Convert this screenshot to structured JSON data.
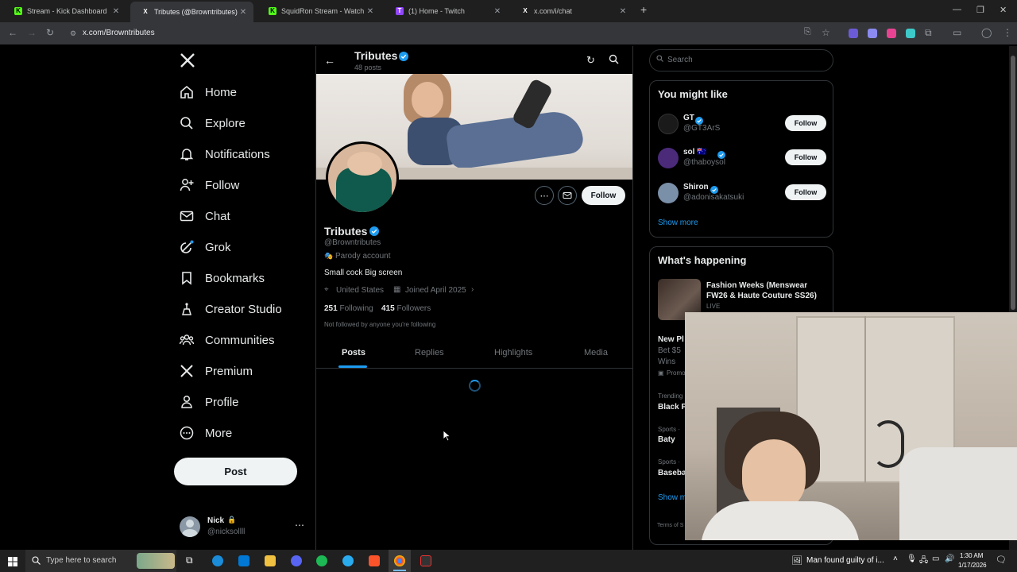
{
  "browser": {
    "tabs": [
      {
        "title": "Stream - Kick Dashboard",
        "fav": "K",
        "fav_color": "#53fc18",
        "active": false
      },
      {
        "title": "Tributes (@Browntributes) / X",
        "fav": "X",
        "fav_color": "#ffffff",
        "active": true
      },
      {
        "title": "SquidRon Stream - Watch Live",
        "fav": "K",
        "fav_color": "#53fc18",
        "active": false
      },
      {
        "title": "(1) Home - Twitch",
        "fav": "T",
        "fav_color": "#9146ff",
        "active": false
      },
      {
        "title": "x.com/i/chat",
        "fav": "X",
        "fav_color": "#ffffff",
        "active": false
      }
    ],
    "url": "x.com/Browntributes"
  },
  "nav": {
    "items": [
      {
        "label": "Home",
        "icon": "home-icon"
      },
      {
        "label": "Explore",
        "icon": "search-icon"
      },
      {
        "label": "Notifications",
        "icon": "bell-icon"
      },
      {
        "label": "Follow",
        "icon": "person-add-icon"
      },
      {
        "label": "Chat",
        "icon": "mail-icon"
      },
      {
        "label": "Grok",
        "icon": "grok-icon"
      },
      {
        "label": "Bookmarks",
        "icon": "bookmark-icon"
      },
      {
        "label": "Creator Studio",
        "icon": "creator-icon"
      },
      {
        "label": "Communities",
        "icon": "communities-icon"
      },
      {
        "label": "Premium",
        "icon": "x-logo-icon"
      },
      {
        "label": "Profile",
        "icon": "person-icon"
      },
      {
        "label": "More",
        "icon": "more-circle-icon"
      }
    ],
    "post_label": "Post",
    "account": {
      "name": "Nick",
      "handle": "@nicksollll"
    }
  },
  "profile": {
    "header_name": "Tributes",
    "post_count": "48 posts",
    "name": "Tributes",
    "handle": "@Browntributes",
    "parody": "Parody account",
    "bio": "Small cock Big screen",
    "location": "United States",
    "joined": "Joined April 2025",
    "following_count": "251",
    "following_label": "Following",
    "followers_count": "415",
    "followers_label": "Followers",
    "not_followed": "Not followed by anyone you're following",
    "follow_label": "Follow",
    "tabs": [
      "Posts",
      "Replies",
      "Highlights",
      "Media"
    ],
    "active_tab": "Posts"
  },
  "right": {
    "search_placeholder": "Search",
    "you_might_like": {
      "title": "You might like",
      "accounts": [
        {
          "name": "GT",
          "handle": "@GT3ArS",
          "follow": "Follow",
          "avatar_color": "#1a1a1a"
        },
        {
          "name": "sol 🇦🇺",
          "handle": "@thaboysol",
          "follow": "Follow",
          "avatar_color": "#4b2a7a"
        },
        {
          "name": "Shiron",
          "handle": "@adonisakatsuki",
          "follow": "Follow",
          "avatar_color": "#7a8fa8"
        }
      ],
      "show_more": "Show more"
    },
    "happening": {
      "title": "What's happening",
      "top_title": "Fashion Weeks (Menswear FW26 & Haute Couture SS26)",
      "top_status": "LIVE",
      "items": [
        {
          "meta": "",
          "title": "New Pl",
          "sub": "Bet $5",
          "sub2": "Wins",
          "sub3": "Promo"
        },
        {
          "meta": "Trending",
          "title": "Black P"
        },
        {
          "meta": "Sports ·",
          "title": "Baty"
        },
        {
          "meta": "Sports ·",
          "title": "Baseba"
        }
      ],
      "show_more": "Show m",
      "footer": "Terms of S"
    }
  },
  "taskbar": {
    "search_placeholder": "Type here to search",
    "news": "Man found guilty of i...",
    "time": "1:30 AM",
    "date": "1/17/2026"
  }
}
